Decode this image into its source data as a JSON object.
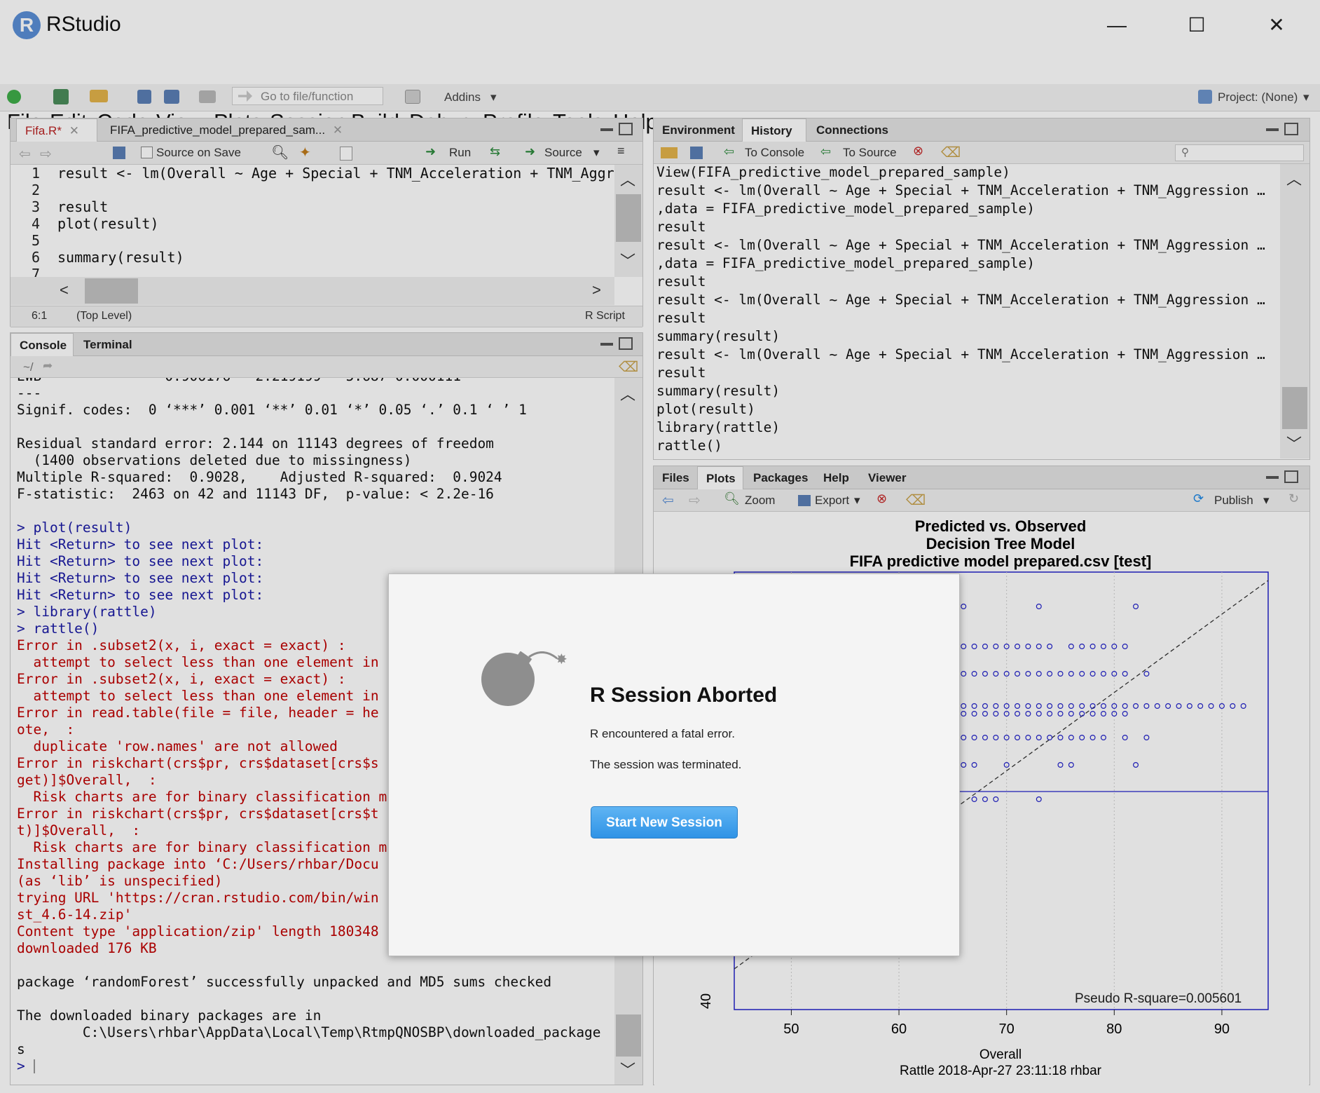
{
  "app": {
    "title": "RStudio",
    "logo": "R"
  },
  "window_controls": {
    "minimize": "—",
    "maximize": "☐",
    "close": "✕"
  },
  "menu": [
    "File",
    "Edit",
    "Code",
    "View",
    "Plots",
    "Session",
    "Build",
    "Debug",
    "Profile",
    "Tools",
    "Help"
  ],
  "toolbar": {
    "goto_placeholder": "Go to file/function",
    "addins_label": "Addins",
    "project_label": "Project: (None)"
  },
  "editor": {
    "tabs": [
      {
        "label": "Fifa.R*"
      },
      {
        "label": "FIFA_predictive_model_prepared_sam..."
      }
    ],
    "source_on_save": "Source on Save",
    "run_label": "Run",
    "source_label": "Source",
    "lines": [
      {
        "n": "1",
        "text": "result <- lm(Overall ~ Age + Special + TNM_Acceleration + TNM_Aggr"
      },
      {
        "n": "2",
        "text": ""
      },
      {
        "n": "3",
        "text": "result"
      },
      {
        "n": "4",
        "text": "plot(result)"
      },
      {
        "n": "5",
        "text": ""
      },
      {
        "n": "6",
        "text": "summary(result)"
      },
      {
        "n": "7",
        "text": ""
      }
    ],
    "status_pos": "6:1",
    "status_scope": "(Top Level)",
    "status_type": "R Script"
  },
  "console": {
    "tabs": [
      {
        "label": "Console"
      },
      {
        "label": "Terminal"
      }
    ],
    "path": "~/",
    "lines": [
      {
        "c": "black",
        "t": "EWB               0.906176   2.219199   5.687 0.000111"
      },
      {
        "c": "black",
        "t": "---"
      },
      {
        "c": "black",
        "t": "Signif. codes:  0 ‘***’ 0.001 ‘**’ 0.01 ‘*’ 0.05 ‘.’ 0.1 ‘ ’ 1"
      },
      {
        "c": "black",
        "t": ""
      },
      {
        "c": "black",
        "t": "Residual standard error: 2.144 on 11143 degrees of freedom"
      },
      {
        "c": "black",
        "t": "  (1400 observations deleted due to missingness)"
      },
      {
        "c": "black",
        "t": "Multiple R-squared:  0.9028,    Adjusted R-squared:  0.9024"
      },
      {
        "c": "black",
        "t": "F-statistic:  2463 on 42 and 11143 DF,  p-value: < 2.2e-16"
      },
      {
        "c": "black",
        "t": ""
      },
      {
        "c": "blue",
        "t": "> plot(result)"
      },
      {
        "c": "blue",
        "t": "Hit <Return> to see next plot:"
      },
      {
        "c": "blue",
        "t": "Hit <Return> to see next plot:"
      },
      {
        "c": "blue",
        "t": "Hit <Return> to see next plot:"
      },
      {
        "c": "blue",
        "t": "Hit <Return> to see next plot:"
      },
      {
        "c": "blue",
        "t": "> library(rattle)"
      },
      {
        "c": "blue",
        "t": "> rattle()"
      },
      {
        "c": "red",
        "t": "Error in .subset2(x, i, exact = exact) :"
      },
      {
        "c": "red",
        "t": "  attempt to select less than one element in"
      },
      {
        "c": "red",
        "t": "Error in .subset2(x, i, exact = exact) :"
      },
      {
        "c": "red",
        "t": "  attempt to select less than one element in"
      },
      {
        "c": "red",
        "t": "Error in read.table(file = file, header = he"
      },
      {
        "c": "red",
        "t": "ote,  :"
      },
      {
        "c": "red",
        "t": "  duplicate 'row.names' are not allowed"
      },
      {
        "c": "red",
        "t": "Error in riskchart(crs$pr, crs$dataset[crs$s"
      },
      {
        "c": "red",
        "t": "get)]$Overall,  :"
      },
      {
        "c": "red",
        "t": "  Risk charts are for binary classification m"
      },
      {
        "c": "red",
        "t": "Error in riskchart(crs$pr, crs$dataset[crs$t"
      },
      {
        "c": "red",
        "t": "t)]$Overall,  :"
      },
      {
        "c": "red",
        "t": "  Risk charts are for binary classification m"
      },
      {
        "c": "red",
        "t": "Installing package into ‘C:/Users/rhbar/Docu"
      },
      {
        "c": "red",
        "t": "(as ‘lib’ is unspecified)"
      },
      {
        "c": "red",
        "t": "trying URL 'https://cran.rstudio.com/bin/win"
      },
      {
        "c": "red",
        "t": "st_4.6-14.zip'"
      },
      {
        "c": "red",
        "t": "Content type 'application/zip' length 180348"
      },
      {
        "c": "red",
        "t": "downloaded 176 KB"
      },
      {
        "c": "black",
        "t": ""
      },
      {
        "c": "black",
        "t": "package ‘randomForest’ successfully unpacked and MD5 sums checked"
      },
      {
        "c": "black",
        "t": ""
      },
      {
        "c": "black",
        "t": "The downloaded binary packages are in"
      },
      {
        "c": "black",
        "t": "        C:\\Users\\rhbar\\AppData\\Local\\Temp\\RtmpQNOSBP\\downloaded_package"
      },
      {
        "c": "black",
        "t": "s"
      },
      {
        "c": "blue",
        "t": "> "
      }
    ]
  },
  "history": {
    "tabs": [
      {
        "label": "Environment"
      },
      {
        "label": "History"
      },
      {
        "label": "Connections"
      }
    ],
    "to_console": "To Console",
    "to_source": "To Source",
    "lines": [
      "View(FIFA_predictive_model_prepared_sample)",
      "result <- lm(Overall ~ Age + Special + TNM_Acceleration + TNM_Aggression …",
      ",data = FIFA_predictive_model_prepared_sample)",
      "result",
      "result <- lm(Overall ~ Age + Special + TNM_Acceleration + TNM_Aggression …",
      ",data = FIFA_predictive_model_prepared_sample)",
      "result",
      "result <- lm(Overall ~ Age + Special + TNM_Acceleration + TNM_Aggression …",
      "result",
      "summary(result)",
      "result <- lm(Overall ~ Age + Special + TNM_Acceleration + TNM_Aggression …",
      "result",
      "summary(result)",
      "plot(result)",
      "library(rattle)",
      "rattle()"
    ]
  },
  "plots": {
    "tabs": [
      {
        "label": "Files"
      },
      {
        "label": "Plots"
      },
      {
        "label": "Packages"
      },
      {
        "label": "Help"
      },
      {
        "label": "Viewer"
      }
    ],
    "zoom_label": "Zoom",
    "export_label": "Export",
    "publish_label": "Publish"
  },
  "chart_data": {
    "type": "scatter",
    "title_lines": [
      "Predicted vs. Observed",
      "Decision Tree Model",
      "FIFA predictive model prepared.csv [test]"
    ],
    "xlabel": "Overall",
    "x_ticks": [
      "50",
      "60",
      "70",
      "80",
      "90"
    ],
    "y_ticks": [
      "40"
    ],
    "annotation": "Pseudo R-square=0.005601",
    "footer": "Rattle 2018-Apr-27 23:11:18 rhbar",
    "point_color": "#2222cc",
    "rows": [
      {
        "y_level": 1,
        "x": [
          66,
          73,
          82
        ]
      },
      {
        "y_level": 2,
        "x": [
          66,
          67,
          68,
          69,
          70,
          71,
          72,
          73,
          74,
          76,
          77,
          78,
          79,
          80,
          81
        ]
      },
      {
        "y_level": 3,
        "x": [
          66,
          67,
          68,
          69,
          70,
          71,
          72,
          73,
          74,
          75,
          76,
          77,
          78,
          79,
          80,
          81,
          83
        ]
      },
      {
        "y_level": 4,
        "x": [
          66,
          67,
          68,
          69,
          70,
          71,
          72,
          73,
          74,
          75,
          76,
          77,
          78,
          79,
          80,
          81,
          82,
          83,
          84,
          85,
          86,
          87,
          88,
          89,
          90,
          91,
          92
        ]
      },
      {
        "y_level": 5,
        "x": [
          66,
          67,
          68,
          69,
          70,
          71,
          72,
          73,
          74,
          75,
          76,
          77,
          78,
          79,
          80,
          81
        ]
      },
      {
        "y_level": 6,
        "x": [
          66,
          67,
          68,
          69,
          70,
          71,
          72,
          73,
          74,
          75,
          76,
          77,
          78,
          79,
          81,
          83
        ]
      },
      {
        "y_level": 7,
        "x": [
          66,
          67,
          70,
          75,
          76,
          82
        ]
      },
      {
        "y_level": 8,
        "x": [
          67,
          68,
          69,
          73
        ]
      }
    ]
  },
  "dialog": {
    "title": "R Session Aborted",
    "message1": "R encountered a fatal error.",
    "message2": "The session was terminated.",
    "button": "Start New Session"
  }
}
